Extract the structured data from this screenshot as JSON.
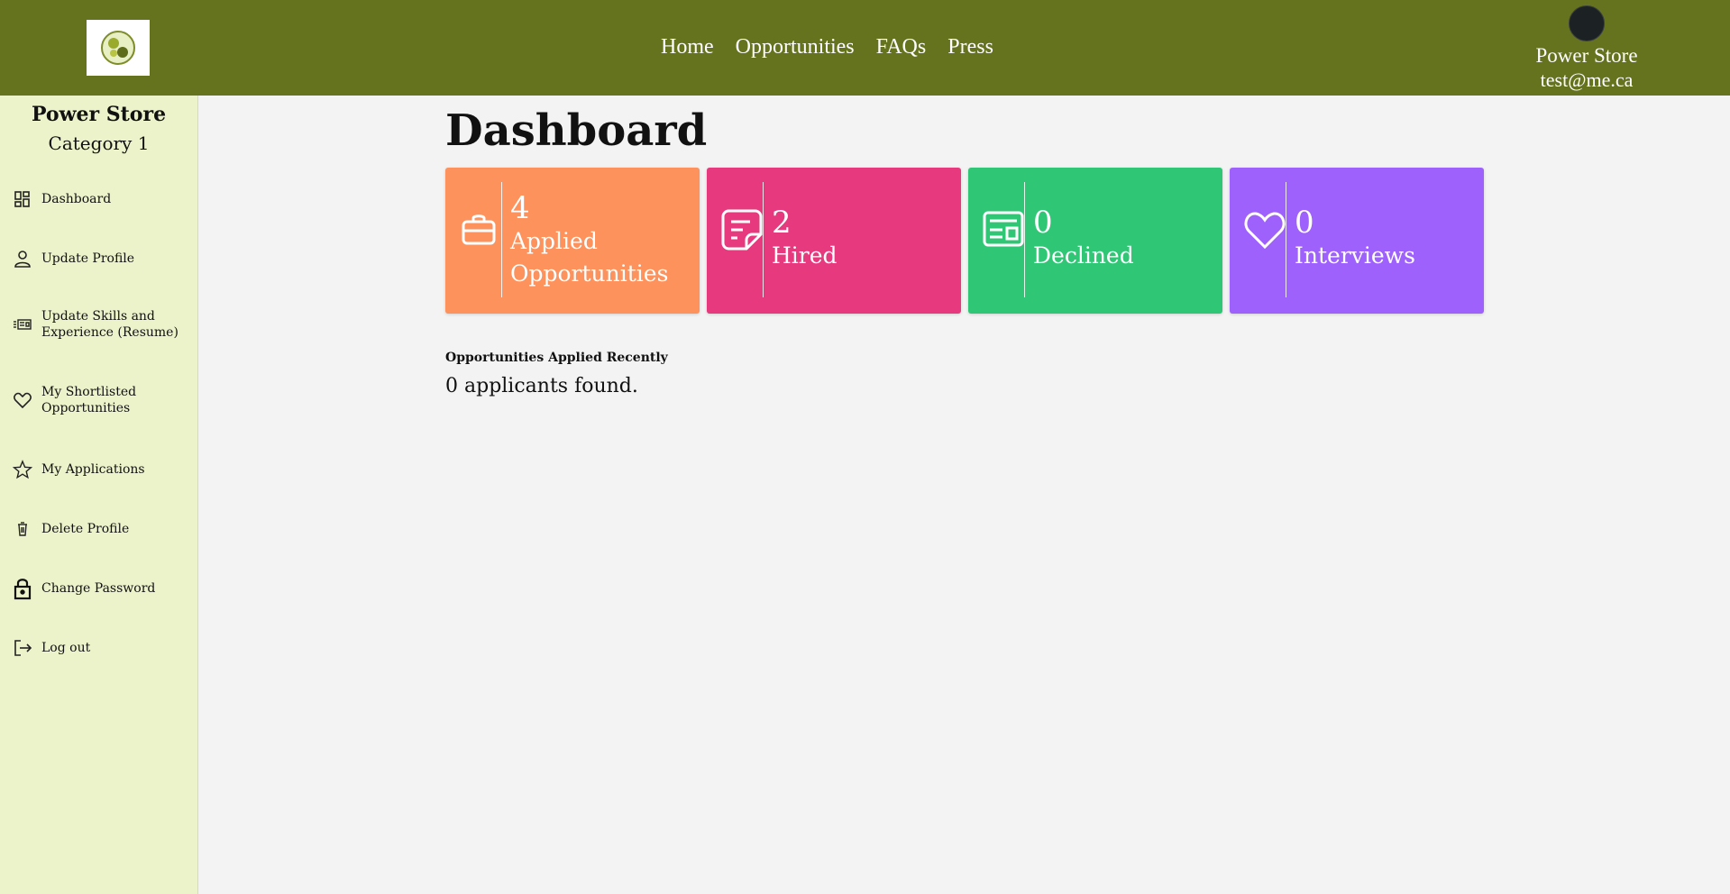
{
  "header": {
    "nav": [
      "Home",
      "Opportunities",
      "FAQs",
      "Press"
    ],
    "user_name": "Power Store",
    "user_email": "test@me.ca"
  },
  "sidebar": {
    "title": "Power Store",
    "subtitle": "Category 1",
    "items": [
      {
        "label": "Dashboard",
        "icon": "dashboard-icon"
      },
      {
        "label": "Update Profile",
        "icon": "person-icon"
      },
      {
        "label": "Update Skills and Experience (Resume)",
        "icon": "resume-icon"
      },
      {
        "label": "My Shortlisted Opportunities",
        "icon": "heart-icon"
      },
      {
        "label": "My Applications",
        "icon": "star-icon"
      },
      {
        "label": "Delete Profile",
        "icon": "trash-icon"
      },
      {
        "label": "Change Password",
        "icon": "lock-icon"
      },
      {
        "label": "Log out",
        "icon": "logout-icon"
      }
    ]
  },
  "main": {
    "title": "Dashboard",
    "cards": [
      {
        "number": "4",
        "label": "Applied Opportunities",
        "icon": "briefcase-icon",
        "color": "#fd925c"
      },
      {
        "number": "2",
        "label": "Hired",
        "icon": "note-icon",
        "color": "#e7397d"
      },
      {
        "number": "0",
        "label": "Declined",
        "icon": "newspaper-icon",
        "color": "#2fc775"
      },
      {
        "number": "0",
        "label": "Interviews",
        "icon": "heart-icon",
        "color": "#9f61fc"
      }
    ],
    "recent_title": "Opportunities Applied Recently",
    "recent_count": "0 applicants found."
  },
  "colors": {
    "header_bg": "#66731e",
    "sidebar_bg": "#ecf3cb",
    "page_bg": "#f3f3f3"
  }
}
